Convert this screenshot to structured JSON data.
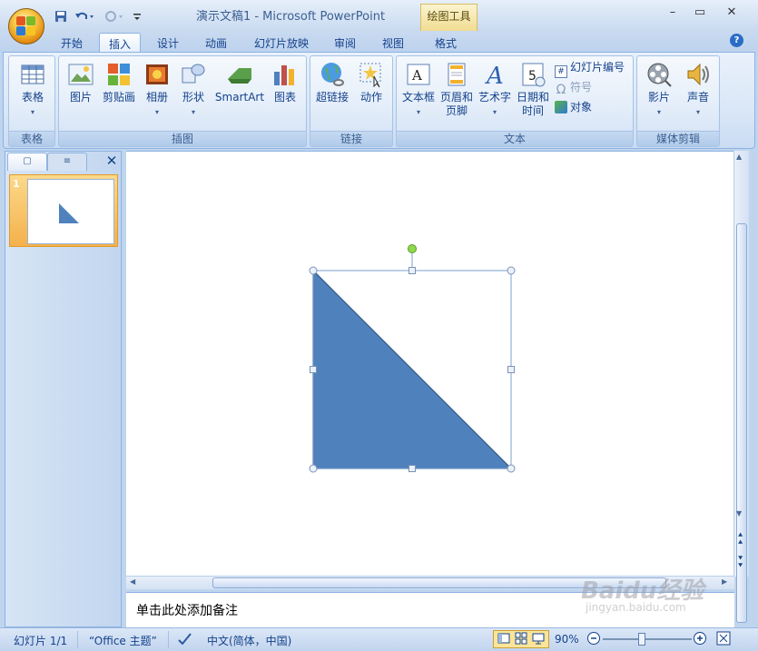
{
  "window": {
    "title": "演示文稿1 - Microsoft PowerPoint",
    "contextual_tools": "绘图工具",
    "minimize_icon": "minimize-icon",
    "maximize_icon": "maximize-icon",
    "close_icon": "close-icon"
  },
  "tabs": [
    "开始",
    "插入",
    "设计",
    "动画",
    "幻灯片放映",
    "审阅",
    "视图",
    "格式"
  ],
  "active_tab": "插入",
  "ribbon": {
    "groups": {
      "table": {
        "label": "表格",
        "buttons": {
          "table": "表格"
        }
      },
      "illustrations": {
        "label": "插图",
        "buttons": {
          "picture": "图片",
          "clipart": "剪贴画",
          "album": "相册",
          "shapes": "形状",
          "smartart": "SmartArt",
          "chart": "图表"
        }
      },
      "links": {
        "label": "链接",
        "buttons": {
          "hyperlink": "超链接",
          "action": "动作"
        }
      },
      "text": {
        "label": "文本",
        "buttons": {
          "textbox": "文本框",
          "header_footer_1": "页眉和",
          "header_footer_2": "页脚",
          "wordart": "艺术字",
          "datetime_1": "日期和",
          "datetime_2": "时间",
          "slide_number": "幻灯片编号",
          "symbol": "符号",
          "object": "对象"
        }
      },
      "media": {
        "label": "媒体剪辑",
        "buttons": {
          "movie": "影片",
          "sound": "声音"
        }
      }
    }
  },
  "slides_pane": {
    "slide_number": "1"
  },
  "notes": {
    "placeholder": "单击此处添加备注"
  },
  "status": {
    "slide": "幻灯片 1/1",
    "theme": "“Office 主题”",
    "language": "中文(简体，中国)",
    "zoom": "90%"
  },
  "watermark": {
    "brand": "Baidu经验",
    "url": "jingyan.baidu.com"
  },
  "colors": {
    "shape_fill": "#4f81bd",
    "shape_stroke": "#385d8a",
    "selection": "#7aa0cc",
    "rotation_handle": "#8fd94a"
  }
}
